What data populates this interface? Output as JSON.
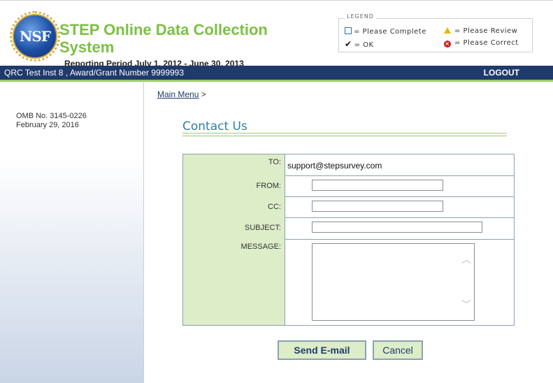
{
  "header": {
    "logo_text": "NSF",
    "title_line1": "STEP Online Data Collection",
    "title_line2": "System",
    "reporting_period": "Reporting Period July 1, 2012 - June 30, 2013"
  },
  "legend": {
    "title": "LEGEND",
    "complete": "= Please Complete",
    "ok": "= OK",
    "review": "= Please Review",
    "correct": "= Please Correct"
  },
  "navbar": {
    "award": "QRC Test Inst 8 , Award/Grant Number 9999993",
    "logout": "LOGOUT"
  },
  "sidebar": {
    "omb_number": "OMB No. 3145-0226",
    "omb_date": "February 29, 2016"
  },
  "breadcrumb": {
    "main_menu": "Main Menu",
    "separator": ">"
  },
  "page": {
    "title": "Contact Us"
  },
  "form": {
    "to_label": "TO:",
    "to_value": "support@stepsurvey.com",
    "from_label": "FROM:",
    "from_value": "",
    "cc_label": "CC:",
    "cc_value": "",
    "subject_label": "SUBJECT:",
    "subject_value": "",
    "message_label": "MESSAGE:",
    "message_value": ""
  },
  "buttons": {
    "send": "Send E-mail",
    "cancel": "Cancel"
  },
  "colors": {
    "brand_green": "#7bc143",
    "nav_blue": "#1f3a6b",
    "label_green": "#dcedc8",
    "heading_blue": "#2f7fa5"
  }
}
